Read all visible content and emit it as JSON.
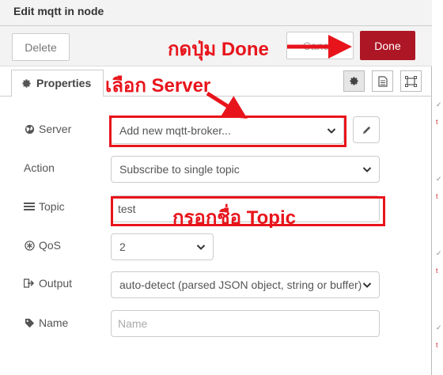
{
  "dialog": {
    "title": "Edit mqtt in node",
    "delete_label": "Delete",
    "cancel_label": "Cancel",
    "done_label": "Done",
    "accent_color": "#ad1625"
  },
  "tabs": {
    "properties_label": "Properties"
  },
  "form": {
    "server": {
      "label": "Server",
      "value": "Add new mqtt-broker..."
    },
    "action": {
      "label": "Action",
      "value": "Subscribe to single topic"
    },
    "topic": {
      "label": "Topic",
      "value": "test"
    },
    "qos": {
      "label": "QoS",
      "value": "2"
    },
    "output": {
      "label": "Output",
      "value": "auto-detect (parsed JSON object, string or buffer)"
    },
    "name": {
      "label": "Name",
      "placeholder": "Name",
      "value": ""
    }
  },
  "annotations": {
    "press_done": "กดปุ่ม Done",
    "choose_server": "เลือก Server",
    "enter_topic": "กรอกชื่อ Topic",
    "color": "#e8141b"
  },
  "icons": {
    "properties": "gear-icon",
    "tab_settings": "gear-icon",
    "tab_description": "document-icon",
    "tab_appearance": "frame-icon",
    "server": "globe-icon",
    "topic": "tasks-icon",
    "qos": "asterisk-icon",
    "output": "sign-out-icon",
    "name": "tag-icon",
    "edit": "pencil-icon"
  }
}
